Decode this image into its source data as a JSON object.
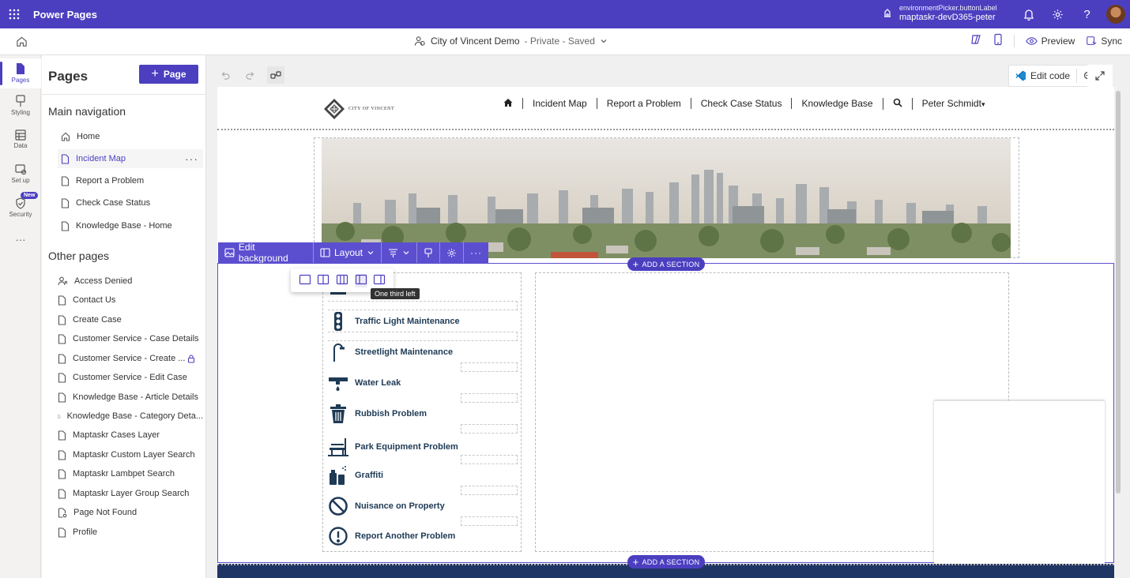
{
  "topbar": {
    "app_name": "Power Pages",
    "env_label": "environmentPicker.buttonLabel",
    "env_name": "maptaskr-devD365-peter"
  },
  "cmdbar": {
    "site_name": "City of Vincent Demo",
    "site_status": "- Private - Saved",
    "preview_label": "Preview",
    "sync_label": "Sync"
  },
  "rail": {
    "pages": "Pages",
    "styling": "Styling",
    "data": "Data",
    "setup": "Set up",
    "security": "Security",
    "new_badge": "New",
    "more": "···"
  },
  "panel": {
    "title": "Pages",
    "add_page_label": "Page",
    "main_nav_heading": "Main navigation",
    "main_nav": [
      {
        "label": "Home"
      },
      {
        "label": "Incident Map"
      },
      {
        "label": "Report a Problem"
      },
      {
        "label": "Check Case Status"
      },
      {
        "label": "Knowledge Base - Home"
      }
    ],
    "other_heading": "Other pages",
    "other_pages": [
      {
        "label": "Access Denied"
      },
      {
        "label": "Contact Us"
      },
      {
        "label": "Create Case"
      },
      {
        "label": "Customer Service - Case Details"
      },
      {
        "label": "Customer Service - Create ..."
      },
      {
        "label": "Customer Service - Edit Case"
      },
      {
        "label": "Knowledge Base - Article Details"
      },
      {
        "label": "Knowledge Base - Category Deta..."
      },
      {
        "label": "Maptaskr Cases Layer"
      },
      {
        "label": "Maptaskr Custom Layer Search"
      },
      {
        "label": "Maptaskr Lambpet Search"
      },
      {
        "label": "Maptaskr Layer Group Search"
      },
      {
        "label": "Page Not Found"
      },
      {
        "label": "Profile"
      }
    ]
  },
  "canvas": {
    "edit_code_label": "Edit code"
  },
  "site": {
    "logo_text": "CITY OF VINCENT",
    "nav": [
      "Incident Map",
      "Report a Problem",
      "Check Case Status",
      "Knowledge Base"
    ],
    "user": "Peter Schmidt"
  },
  "edit_toolbar": {
    "edit_background": "Edit background",
    "layout": "Layout"
  },
  "add_section_label": "ADD A SECTION",
  "tooltip": "One third left",
  "services": [
    {
      "label": "Traffic Light Maintenance",
      "icon": "traffic-light-icon"
    },
    {
      "label": "Streetlight Maintenance",
      "icon": "streetlight-icon"
    },
    {
      "label": "Water Leak",
      "icon": "water-leak-icon"
    },
    {
      "label": "Rubbish Problem",
      "icon": "rubbish-bin-icon"
    },
    {
      "label": "Park Equipment Problem",
      "icon": "park-bench-icon"
    },
    {
      "label": "Graffiti",
      "icon": "spray-can-icon"
    },
    {
      "label": "Nuisance on Property",
      "icon": "prohibited-icon"
    },
    {
      "label": "Report Another Problem",
      "icon": "exclamation-icon"
    }
  ],
  "colors": {
    "brand": "#4b3fc0",
    "toolbar": "#5b4fd0",
    "service_text": "#1e3a55",
    "footer": "#1f3564"
  }
}
